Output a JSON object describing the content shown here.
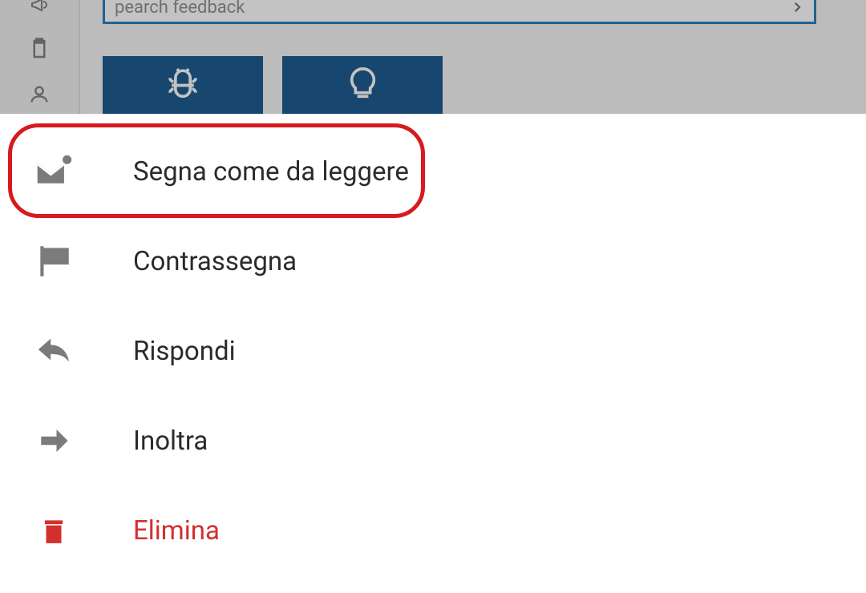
{
  "search": {
    "placeholder": "pearch feedback"
  },
  "menu": {
    "items": [
      {
        "label": "Segna come da leggere",
        "type": "normal",
        "highlighted": true,
        "icon": "mail-unread"
      },
      {
        "label": "Contrassegna",
        "type": "normal",
        "highlighted": false,
        "icon": "flag"
      },
      {
        "label": "Rispondi",
        "type": "normal",
        "highlighted": false,
        "icon": "reply"
      },
      {
        "label": "Inoltra",
        "type": "normal",
        "highlighted": false,
        "icon": "forward"
      },
      {
        "label": "Elimina",
        "type": "danger",
        "highlighted": false,
        "icon": "trash"
      }
    ]
  }
}
